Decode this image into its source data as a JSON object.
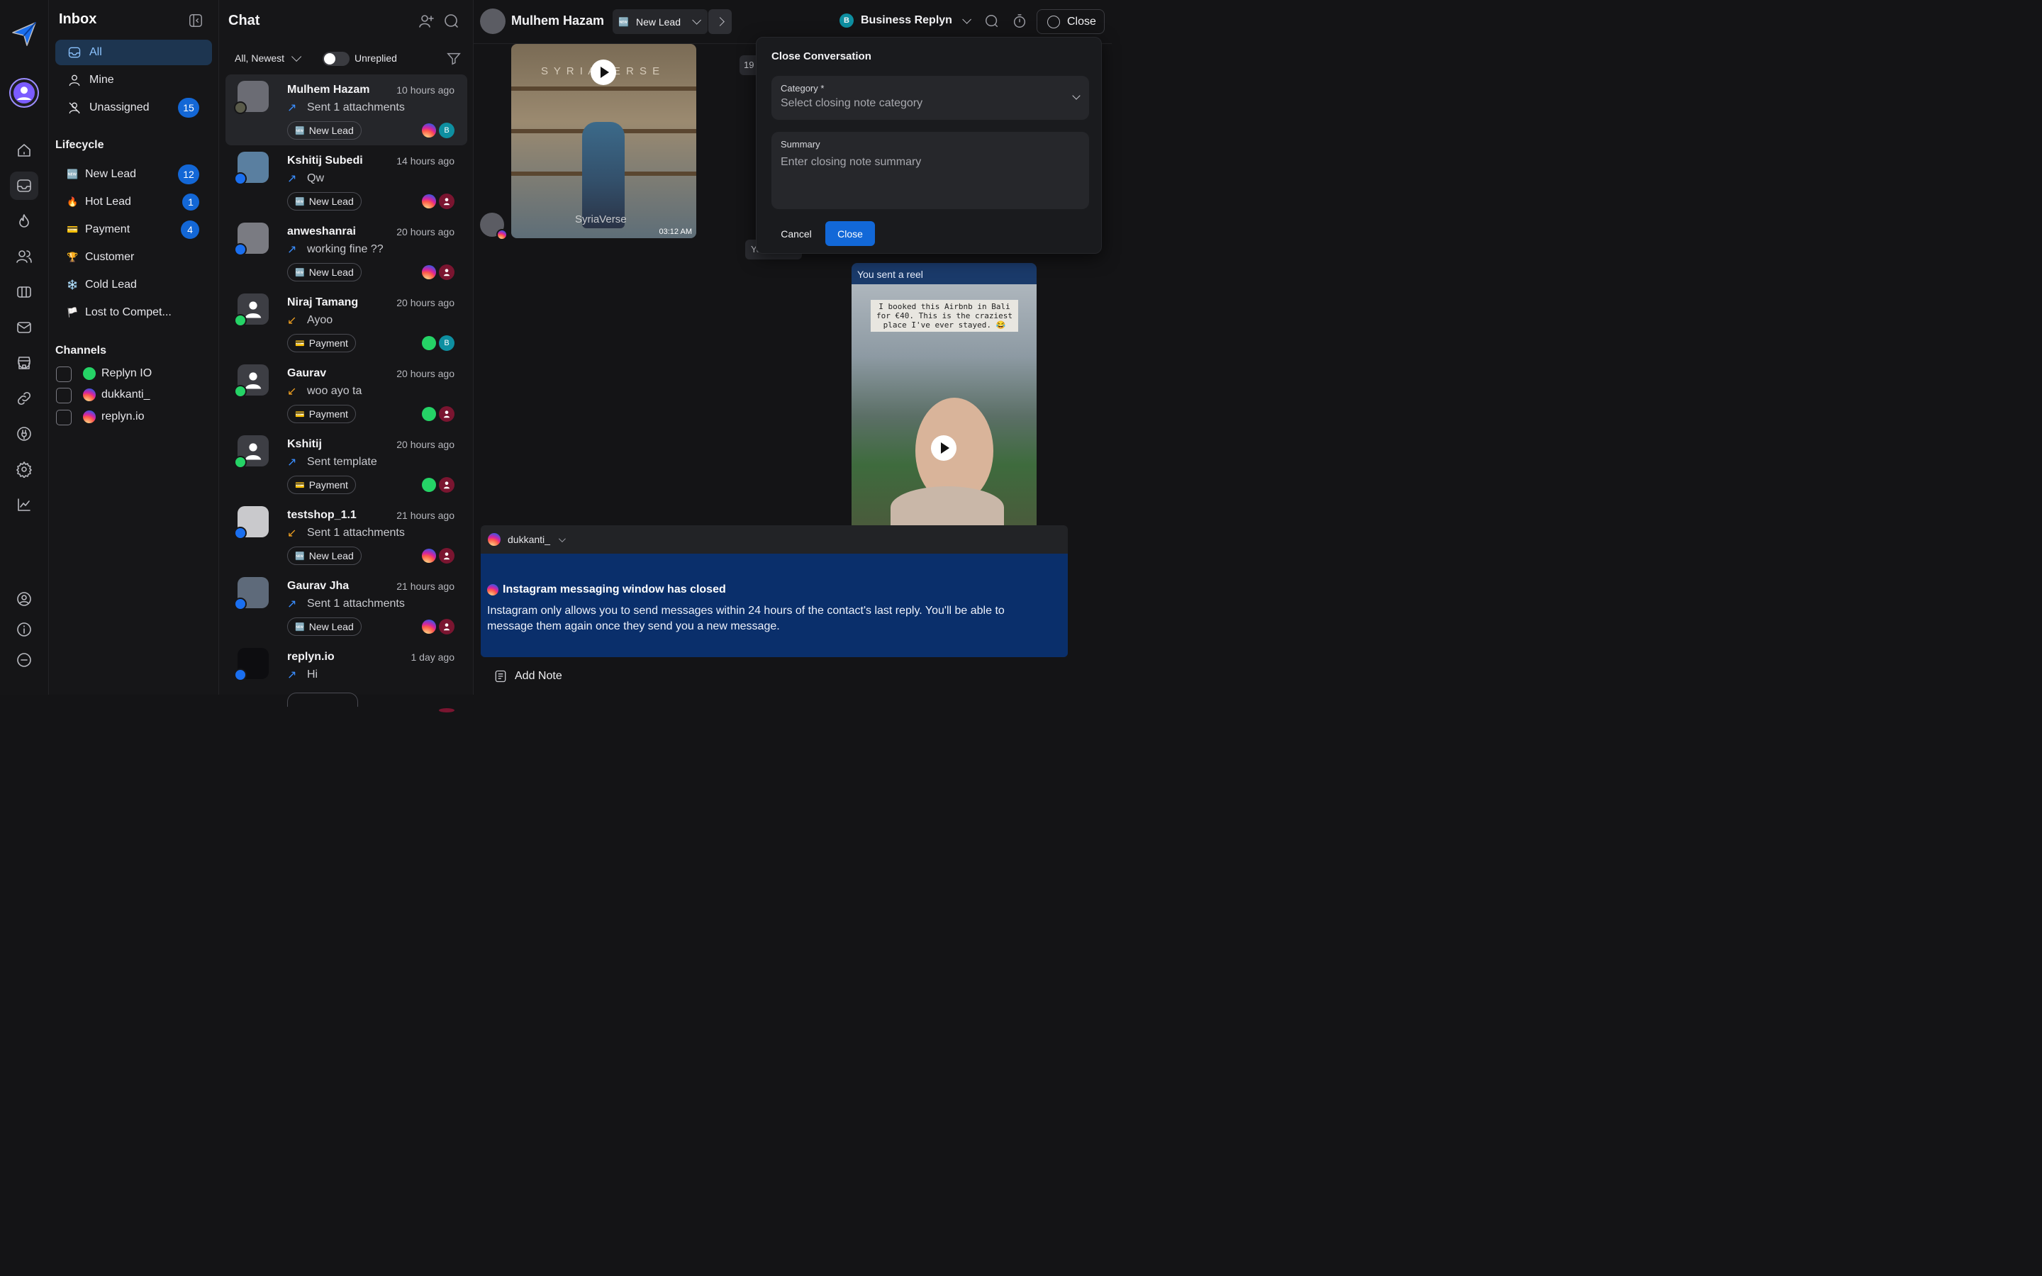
{
  "inbox": {
    "title": "Inbox",
    "nav": [
      {
        "label": "All",
        "selected": true
      },
      {
        "label": "Mine"
      },
      {
        "label": "Unassigned",
        "count": "15"
      }
    ],
    "lifecycle_title": "Lifecycle",
    "lifecycle": [
      {
        "emoji": "🆕",
        "label": "New Lead",
        "count": "12"
      },
      {
        "emoji": "🔥",
        "label": "Hot Lead",
        "count": "1"
      },
      {
        "emoji": "💳",
        "label": "Payment",
        "count": "4"
      },
      {
        "emoji": "🏆",
        "label": "Customer"
      },
      {
        "emoji": "❄️",
        "label": "Cold Lead"
      },
      {
        "emoji": "🏳️",
        "label": "Lost to Compet..."
      }
    ],
    "channels_title": "Channels",
    "channels": [
      {
        "label": "Replyn IO",
        "type": "whatsapp"
      },
      {
        "label": "dukkanti_",
        "type": "instagram"
      },
      {
        "label": "replyn.io",
        "type": "instagram"
      }
    ]
  },
  "chat": {
    "title": "Chat",
    "filter": "All, Newest",
    "unreplied": "Unreplied",
    "items": [
      {
        "name": "Mulhem Hazam",
        "time": "10 hours ago",
        "dir": "out",
        "msg": "Sent 1 attachments",
        "tag_emoji": "🆕",
        "tag": "New Lead",
        "ch": "instagram",
        "agent": "B"
      },
      {
        "name": "Kshitij Subedi",
        "time": "14 hours ago",
        "dir": "out",
        "msg": "Qw",
        "tag_emoji": "🆕",
        "tag": "New Lead",
        "ch": "instagram",
        "agent": ""
      },
      {
        "name": "anweshanrai",
        "time": "20 hours ago",
        "dir": "out",
        "msg": "working fine ??",
        "tag_emoji": "🆕",
        "tag": "New Lead",
        "ch": "instagram",
        "agent": ""
      },
      {
        "name": "Niraj Tamang",
        "time": "20 hours ago",
        "dir": "in",
        "msg": "Ayoo",
        "tag_emoji": "💳",
        "tag": "Payment",
        "ch": "whatsapp",
        "agent": "B"
      },
      {
        "name": "Gaurav",
        "time": "20 hours ago",
        "dir": "in",
        "msg": "woo ayo ta",
        "tag_emoji": "💳",
        "tag": "Payment",
        "ch": "whatsapp",
        "agent": ""
      },
      {
        "name": "Kshitij",
        "time": "20 hours ago",
        "dir": "out",
        "msg": "Sent template",
        "tag_emoji": "💳",
        "tag": "Payment",
        "ch": "whatsapp",
        "agent": ""
      },
      {
        "name": "testshop_1.1",
        "time": "21 hours ago",
        "dir": "in",
        "msg": "Sent 1 attachments",
        "tag_emoji": "🆕",
        "tag": "New Lead",
        "ch": "instagram",
        "agent": ""
      },
      {
        "name": "Gaurav Jha",
        "time": "21 hours ago",
        "dir": "out",
        "msg": "Sent 1 attachments",
        "tag_emoji": "🆕",
        "tag": "New Lead",
        "ch": "instagram",
        "agent": ""
      },
      {
        "name": "replyn.io",
        "time": "1 day ago",
        "dir": "out",
        "msg": "Hi",
        "tag_emoji": "",
        "tag": "",
        "ch": "",
        "agent": ""
      }
    ]
  },
  "conversation": {
    "contact": "Mulhem Hazam",
    "stage_emoji": "🆕",
    "stage": "New Lead",
    "account_initial": "B",
    "account": "Business Replyn",
    "close_label": "Close",
    "media_time": "03:12 AM",
    "media_watermark": "SyriaVerse",
    "media_brand": "S Y R I A V E R S E",
    "hidden_timestamp_prefix": "19",
    "hidden_you_prefix": "Yo",
    "reel_label": "You sent a reel",
    "reel_caption": "I booked this Airbnb in Bali for €40. This is the craziest place I've ever stayed. 😂",
    "composer_account": "dukkanti_",
    "warning_title": "Instagram messaging window has closed",
    "warning_body": "Instagram only allows you to send messages within 24 hours of the contact's last reply. You'll be able to message them again once they send you a new message.",
    "add_note": "Add Note"
  },
  "close_panel": {
    "title": "Close Conversation",
    "category_label": "Category *",
    "category_placeholder": "Select closing note category",
    "summary_label": "Summary",
    "summary_placeholder": "Enter closing note summary",
    "cancel": "Cancel",
    "confirm": "Close"
  },
  "colors": {
    "accent": "#1268d8",
    "selected_nav": "#1d3550",
    "warning_bg": "#0a2f6b"
  }
}
